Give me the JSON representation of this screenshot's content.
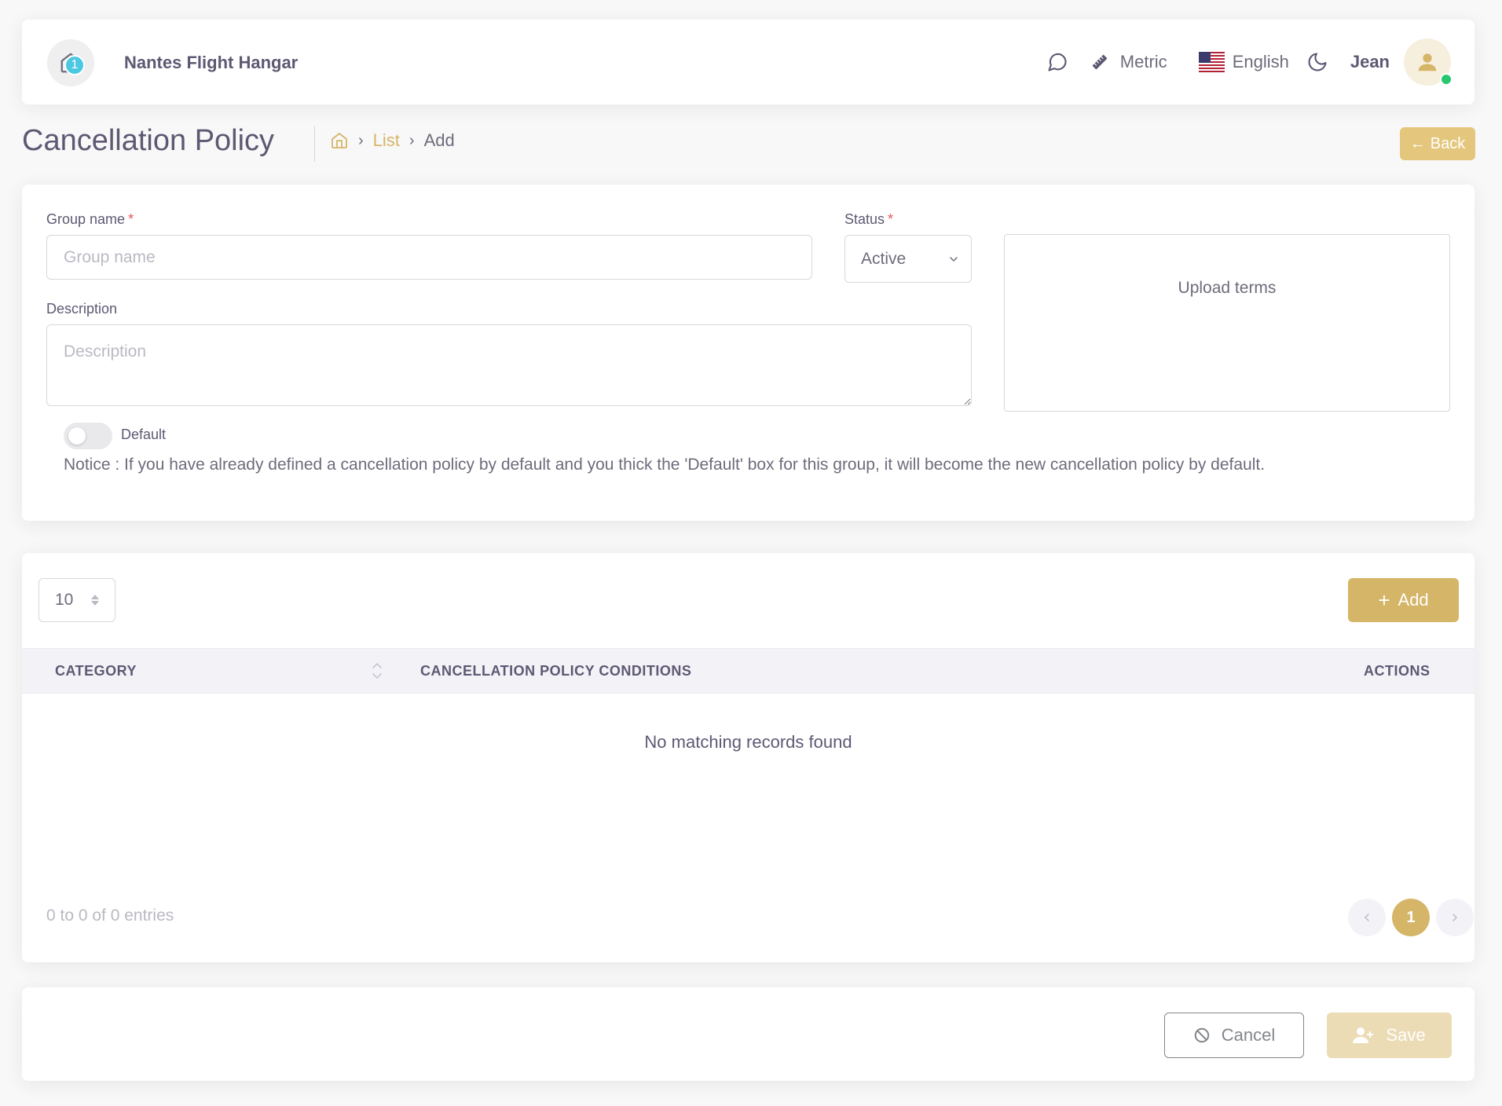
{
  "navbar": {
    "notification_count": "1",
    "brand_name": "Nantes Flight Hangar",
    "units_label": "Metric",
    "language_label": "English",
    "user_name": "Jean"
  },
  "header": {
    "title": "Cancellation Policy",
    "breadcrumb": {
      "list": "List",
      "current": "Add"
    },
    "back_label": "Back"
  },
  "form": {
    "group_name_label": "Group name",
    "group_name_placeholder": "Group name",
    "status_label": "Status",
    "status_value": "Active",
    "description_label": "Description",
    "description_placeholder": "Description",
    "upload_label": "Upload terms",
    "default_label": "Default",
    "notice": "Notice : If you have already defined a cancellation policy by default and you thick the 'Default' box for this group, it will become the new cancellation policy by default.",
    "required_mark": "*"
  },
  "table": {
    "page_length": "10",
    "add_label": "Add",
    "columns": [
      "CATEGORY",
      "CANCELLATION POLICY CONDITIONS",
      "ACTIONS"
    ],
    "empty_message": "No matching records found",
    "entries_info": "0 to 0 of 0 entries",
    "current_page": "1"
  },
  "footer": {
    "cancel_label": "Cancel",
    "save_label": "Save"
  },
  "colors": {
    "accent": "#d5b567",
    "badge": "#4cc8e3",
    "online": "#28c76f",
    "required": "#ea5455"
  }
}
